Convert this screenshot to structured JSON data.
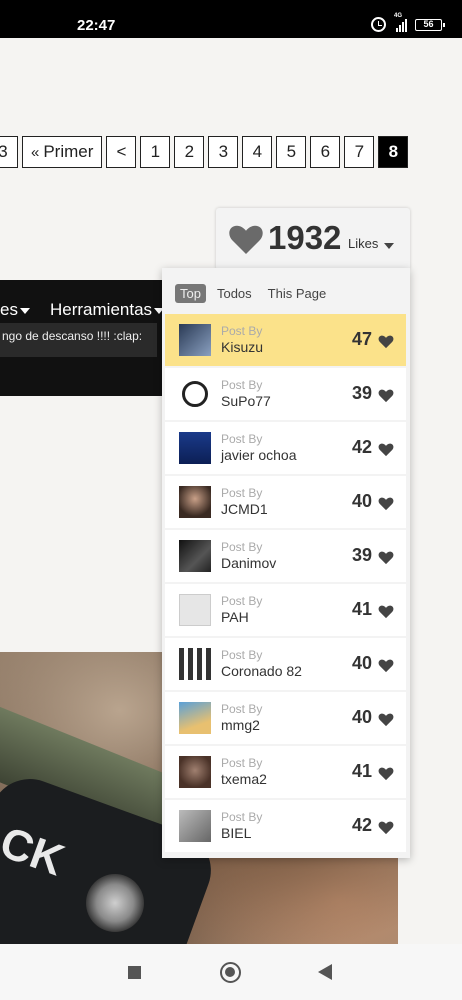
{
  "status_bar": {
    "time": "22:47",
    "network": "4G",
    "battery": "56"
  },
  "pagination": {
    "prev_partial": "3",
    "first_label": "Primer",
    "first_prefix": "«",
    "prev_label": "<",
    "pages": [
      "1",
      "2",
      "3",
      "4",
      "5",
      "6",
      "7",
      "8"
    ],
    "current": "8"
  },
  "likes": {
    "total": "1932",
    "label": "Likes",
    "tabs": [
      "Top",
      "Todos",
      "This Page"
    ],
    "active_tab": "Top",
    "post_by_label": "Post By",
    "highlight_color": "#fbe28a",
    "rows": [
      {
        "user": "Kisuzu",
        "count": "47",
        "avatar": "watch-avatar"
      },
      {
        "user": "SuPo77",
        "count": "39",
        "avatar": "watch-face-avatar"
      },
      {
        "user": "javier ochoa",
        "count": "42",
        "avatar": "blue-avatar"
      },
      {
        "user": "JCMD1",
        "count": "40",
        "avatar": "face-avatar"
      },
      {
        "user": "Danimov",
        "count": "39",
        "avatar": "dark-avatar"
      },
      {
        "user": "PAH",
        "count": "41",
        "avatar": "default-avatar"
      },
      {
        "user": "Coronado 82",
        "count": "40",
        "avatar": "watches-avatar"
      },
      {
        "user": "mmg2",
        "count": "40",
        "avatar": "sky-avatar"
      },
      {
        "user": "txema2",
        "count": "41",
        "avatar": "wolf-avatar"
      },
      {
        "user": "BIEL",
        "count": "42",
        "avatar": "gray-avatar"
      }
    ]
  },
  "forum_nav": {
    "item_partial": "es",
    "item_tools": "Herramientas",
    "message": "ngo de descanso !!!! :clap:"
  },
  "photo": {
    "text": "CK"
  }
}
